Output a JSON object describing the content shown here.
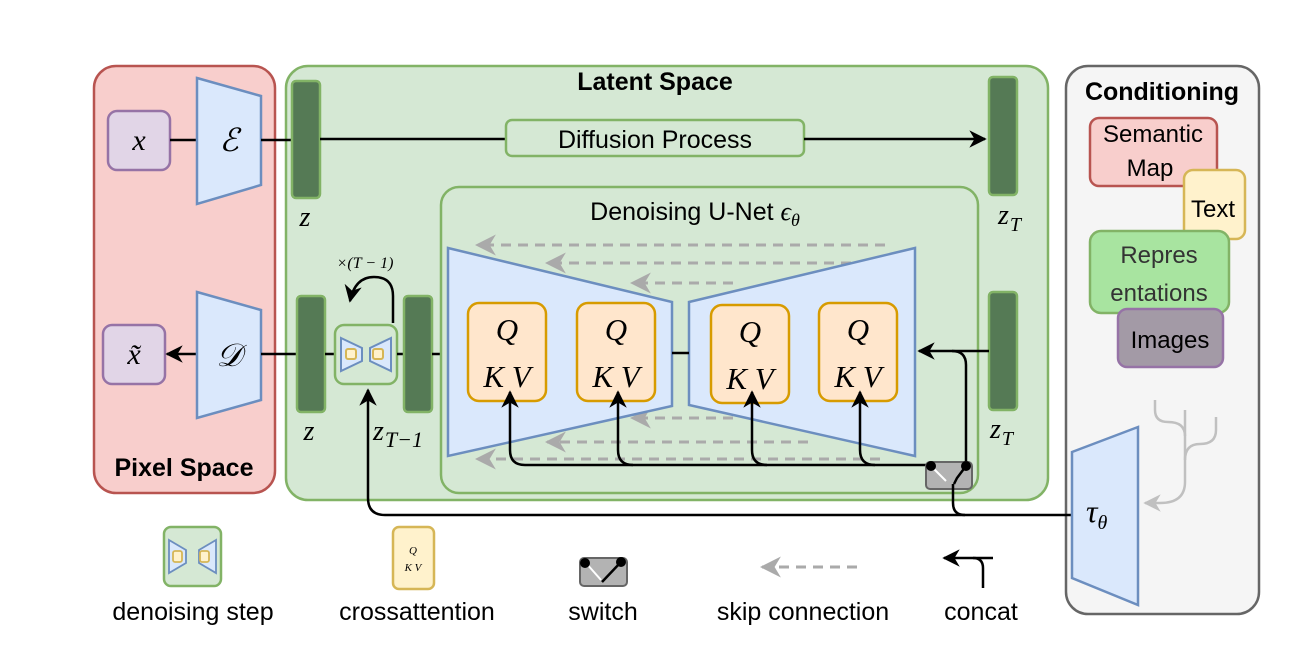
{
  "panels": {
    "pixel_space": {
      "title": "Pixel Space"
    },
    "latent_space": {
      "title": "Latent Space"
    },
    "conditioning": {
      "title": "Conditioning"
    }
  },
  "pixel": {
    "input_label": "x",
    "output_label": "x̃",
    "encoder_label": "ℰ",
    "decoder_label": "𝒟"
  },
  "latent": {
    "diffusion_process": "Diffusion Process",
    "z_top": "z",
    "zT_top_base": "z",
    "zT_top_sub": "T",
    "z_bottom": "z",
    "zT1_base": "z",
    "zT1_sub": "T−1",
    "zT_bottom_base": "z",
    "zT_bottom_sub": "T",
    "repeat_label": "×(T − 1)"
  },
  "unet": {
    "title_text": "Denoising U-Net ",
    "title_symbol": "ϵ",
    "title_sub": "θ",
    "attention_blocks": [
      {
        "q": "Q",
        "kv": "K V"
      },
      {
        "q": "Q",
        "kv": "K V"
      },
      {
        "q": "Q",
        "kv": "K V"
      },
      {
        "q": "Q",
        "kv": "K V"
      }
    ]
  },
  "conditioning": {
    "inputs": [
      "Semantic\nMap",
      "Text",
      "Repres\nentations",
      "Images"
    ],
    "semantic_map_line1": "Semantic",
    "semantic_map_line2": "Map",
    "text": "Text",
    "representations_line1": "Repres",
    "representations_line2": "entations",
    "images": "Images",
    "encoder_symbol": "τ",
    "encoder_sub": "θ"
  },
  "legend": {
    "items": [
      {
        "icon": "denoising-step-icon",
        "label": "denoising step"
      },
      {
        "icon": "crossattention-icon",
        "label": "crossattention",
        "q": "Q",
        "kv": "K V"
      },
      {
        "icon": "switch-icon",
        "label": "switch"
      },
      {
        "icon": "skip-connection-icon",
        "label": "skip connection"
      },
      {
        "icon": "concat-icon",
        "label": "concat"
      }
    ]
  },
  "colors": {
    "pixel_fill": "#f8cecc",
    "pixel_stroke": "#b85450",
    "latent_fill": "#d5e8d4",
    "latent_stroke": "#82b366",
    "latent_block": "#557a55",
    "conditioning_fill": "#f5f5f5",
    "conditioning_stroke": "#666666",
    "trapezoid_fill": "#dae8fc",
    "trapezoid_stroke": "#6c8ebf",
    "attention_fill": "#ffe6cc",
    "attention_stroke": "#d79b00",
    "io_fill": "#e1d5e7",
    "io_stroke": "#9673a6",
    "text_fill": "#fff2cc",
    "text_stroke": "#d6b656",
    "repr_fill": "#a8e4a0",
    "images_fill": "#a39aa6",
    "skip_gray": "#aaaaaa",
    "switch_fill": "#b3b3b3"
  }
}
